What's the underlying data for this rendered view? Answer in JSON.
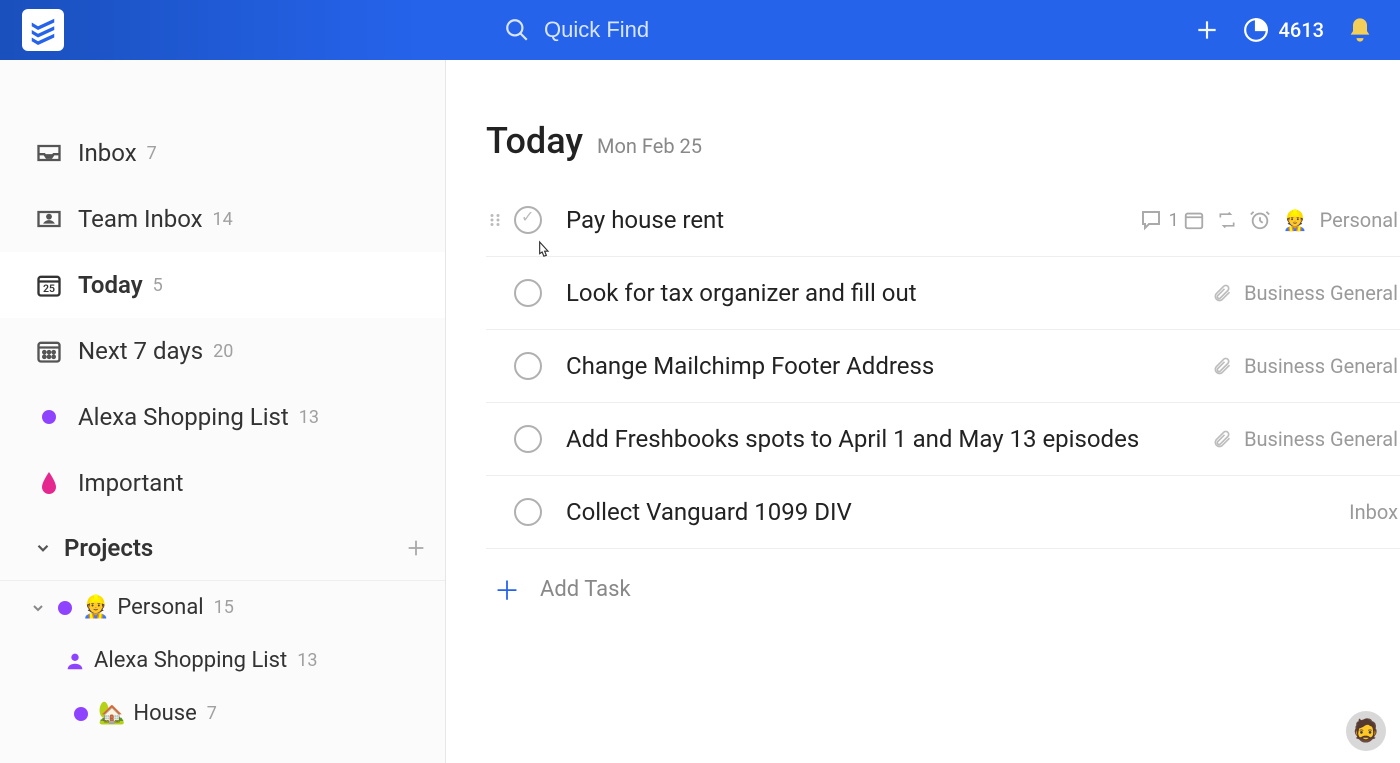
{
  "header": {
    "search_placeholder": "Quick Find",
    "karma": "4613"
  },
  "sidebar": {
    "items": [
      {
        "label": "Inbox",
        "count": "7"
      },
      {
        "label": "Team Inbox",
        "count": "14"
      },
      {
        "label": "Today",
        "count": "5"
      },
      {
        "label": "Next 7 days",
        "count": "20"
      },
      {
        "label": "Alexa Shopping List",
        "count": "13"
      },
      {
        "label": "Important",
        "count": ""
      }
    ],
    "projects_label": "Projects",
    "project": {
      "label": "Personal",
      "count": "15"
    },
    "subprojects": [
      {
        "label": "Alexa Shopping List",
        "count": "13",
        "emoji": ""
      },
      {
        "label": "House",
        "count": "7",
        "emoji": "🏡"
      }
    ]
  },
  "view": {
    "title": "Today",
    "date": "Mon Feb 25",
    "add_task_label": "Add Task"
  },
  "tasks": [
    {
      "title": "Pay house rent",
      "comments": "1",
      "project": "Personal"
    },
    {
      "title": "Look for tax organizer and fill out",
      "project": "Business General"
    },
    {
      "title": "Change Mailchimp Footer Address",
      "project": "Business General"
    },
    {
      "title": "Add Freshbooks spots to April 1 and May 13 episodes",
      "project": "Business General"
    },
    {
      "title": "Collect Vanguard 1099 DIV",
      "project": "Inbox"
    }
  ]
}
